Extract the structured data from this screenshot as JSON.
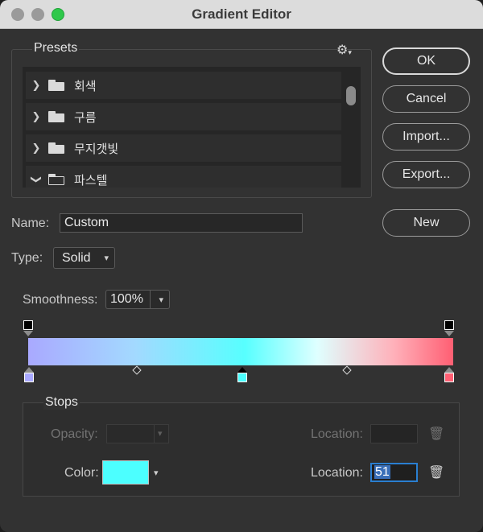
{
  "window": {
    "title": "Gradient Editor"
  },
  "presets": {
    "title": "Presets",
    "gear_icon": "gear-icon",
    "items": [
      {
        "label": "회색",
        "expanded": false
      },
      {
        "label": "구름",
        "expanded": false
      },
      {
        "label": "무지갯빛",
        "expanded": false
      },
      {
        "label": "파스텔",
        "expanded": true
      }
    ]
  },
  "buttons": {
    "ok": "OK",
    "cancel": "Cancel",
    "import": "Import...",
    "export": "Export...",
    "new": "New"
  },
  "name": {
    "label": "Name:",
    "value": "Custom"
  },
  "type": {
    "label": "Type:",
    "value": "Solid"
  },
  "smoothness": {
    "label": "Smoothness:",
    "value": "100%"
  },
  "gradient": {
    "colors": [
      "#a9a9ff",
      "#a3d9ff",
      "#57ffff",
      "#dfffff",
      "#ffb1ba",
      "#ff5f73"
    ],
    "color_stops": [
      {
        "location": 0,
        "color": "#a9a9ff"
      },
      {
        "location": 51,
        "color": "#4cffff",
        "selected": true
      },
      {
        "location": 100,
        "color": "#ff5f73"
      }
    ],
    "opacity_stops": [
      {
        "location": 0
      },
      {
        "location": 100
      }
    ]
  },
  "stops": {
    "title": "Stops",
    "opacity_label": "Opacity:",
    "opacity_location_label": "Location:",
    "color_label": "Color:",
    "color_value": "#4cffff",
    "color_location_label": "Location:",
    "color_location_value": "51"
  }
}
